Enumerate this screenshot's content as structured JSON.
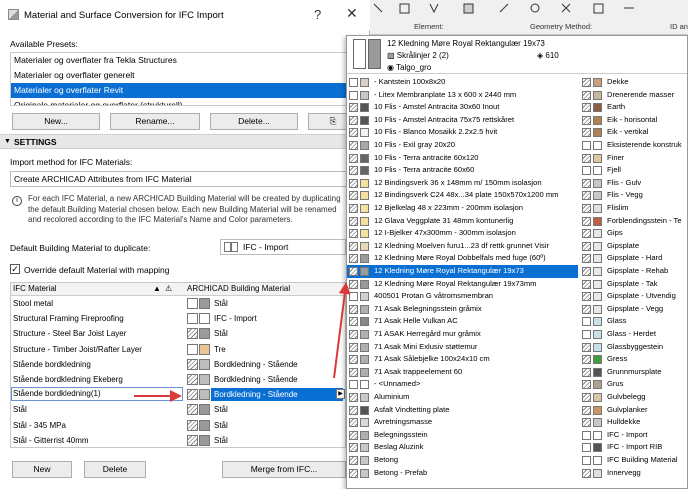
{
  "dialog": {
    "title": "Material and Surface Conversion for IFC Import",
    "help": "?",
    "close": "✕",
    "available_presets_label": "Available Presets:",
    "presets": [
      {
        "label": "Materialer og overflater fra Tekla Structures",
        "selected": false
      },
      {
        "label": "Materialer og overflater generelt",
        "selected": false
      },
      {
        "label": "Materialer og overflater Revit",
        "selected": true
      },
      {
        "label": "Originale materialer og overflater (strukturell)",
        "selected": false
      }
    ],
    "buttons": {
      "new": "New...",
      "rename": "Rename...",
      "delete": "Delete...",
      "import": "⎘"
    },
    "settings_label": "SETTINGS",
    "import_method_label": "Import method for IFC Materials:",
    "import_method_value": "Create ARCHICAD Attributes from IFC Material",
    "info_lines": [
      "For each IFC Material, a new ARCHICAD Building Material will be created by duplicating",
      "the default Building Material chosen below. Each new Building Material will be renamed",
      "and recolored according to the IFC Material's Name and Color parameters."
    ],
    "default_bm_label": "Default Building Material to duplicate:",
    "default_bm_value": "IFC - Import",
    "override_label": "Override default Material with mapping",
    "override_checked": true,
    "table": {
      "col1": "IFC Material",
      "col2": "ARCHICAD Building Material",
      "rows": [
        {
          "ifc": "Stool metal",
          "bm": "Stål",
          "sw": "blank",
          "sw2": "gray"
        },
        {
          "ifc": "Structural Framing Fireproofing",
          "bm": "IFC - Import",
          "sw": "blank",
          "sw2": "blank"
        },
        {
          "ifc": "Structure - Steel Bar Joist Layer",
          "bm": "Stål",
          "sw": "hatch",
          "sw2": "gray"
        },
        {
          "ifc": "Structure - Timber Joist/Rafter Layer",
          "bm": "Tre",
          "sw": "blank",
          "sw2": "tan"
        },
        {
          "ifc": "Stående bordkledning",
          "bm": "Bordkledning - Stående",
          "sw": "hatch",
          "sw2": "lightgray"
        },
        {
          "ifc": "Stående bordkledning Ekeberg",
          "bm": "Bordkledning - Stående",
          "sw": "hatch",
          "sw2": "lightgray"
        },
        {
          "ifc": "Stående bordkledning(1)",
          "bm": "Bordkledning - Stående",
          "sw": "hatch",
          "sw2": "lightgray",
          "selected": true
        },
        {
          "ifc": "Stål",
          "bm": "Stål",
          "sw": "hatch",
          "sw2": "gray"
        },
        {
          "ifc": "Stål - 345 MPa",
          "bm": "Stål",
          "sw": "hatch",
          "sw2": "gray"
        },
        {
          "ifc": "Stål - Gitterrist 40mm",
          "bm": "Stål",
          "sw": "hatch",
          "sw2": "gray"
        }
      ]
    },
    "bottom_buttons": {
      "new": "New",
      "delete": "Delete",
      "merge": "Merge from IFC..."
    }
  },
  "background": {
    "col_element": "Element:",
    "col_geometry": "Geometry Method:",
    "col_id": "ID an"
  },
  "popup": {
    "preview": {
      "name": "12 Kledning Møre Royal Rektangulær 19x73",
      "pattern": "Skrålinjer 2 (2)",
      "priority": "610",
      "surface": "Talgo_gro"
    },
    "left_items": [
      {
        "label": "Kantstein 100x8x20",
        "s1": "blank",
        "s2": "#d8d0c8",
        "prefix": "-"
      },
      {
        "label": "Litex Membranplate 13 x 600 x 2440 mm",
        "s1": "blank",
        "s2": "#c8c8c8",
        "prefix": "-"
      },
      {
        "label": "10  Flis - Amstel Antracita 30x60 Inout",
        "s1": "hatch",
        "s2": "#555555"
      },
      {
        "label": "10  Flis - Amstel Antracita 75x75 rettskåret",
        "s1": "hatch",
        "s2": "#555555"
      },
      {
        "label": "10  Flis - Blanco Mosaikk 2.2x2.5 hvit",
        "s1": "hatch",
        "s2": "#f2f2f2"
      },
      {
        "label": "10  Flis - Exil gray 20x20",
        "s1": "hatch",
        "s2": "#a8a8a8"
      },
      {
        "label": "10  Flis - Terra antracite 60x120",
        "s1": "hatch",
        "s2": "#666666"
      },
      {
        "label": "10  Flis - Terra antracite 60x60",
        "s1": "hatch",
        "s2": "#666666"
      },
      {
        "label": "12  Bindingsverk 36 x 148mm  m/ 150mm isolasjon",
        "s1": "hatch",
        "s2": "#f5e0a0"
      },
      {
        "label": "12  Bindingsverk C24 48x...34 plate 150x570x1200 mm",
        "s1": "hatch",
        "s2": "#f5e0a0"
      },
      {
        "label": "12  Bjelkelag 48 x 223mm - 200mm isolasjon",
        "s1": "hatch",
        "s2": "#f5e0a0"
      },
      {
        "label": "12  Glava Veggplate 31 48mm kontunerlig",
        "s1": "hatch",
        "s2": "#f5e0a0"
      },
      {
        "label": "12  I-Bjelker 47x300mm - 300mm isolasjon",
        "s1": "hatch",
        "s2": "#f5e0a0"
      },
      {
        "label": "12  Kledning Moelven furu1...23 df rettk grunnet Visir",
        "s1": "hatch",
        "s2": "#e8d8b8"
      },
      {
        "label": "12  Kledning Møre Royal Dobbelfals med fuge (60º)",
        "s1": "hatch",
        "s2": "#9a9a9a"
      },
      {
        "label": "12  Kledning Møre Royal Rektangulær 19x73",
        "s1": "hatch",
        "s2": "#9a9a9a",
        "selected": true
      },
      {
        "label": "12  Kledning Møre Royal Rektangulær 19x73mm",
        "s1": "hatch",
        "s2": "#9a9a9a"
      },
      {
        "label": "400501  Protan G våtromsmembran",
        "s1": "blank",
        "s2": "#d0d0d0",
        "noindent": true
      },
      {
        "label": "71  Asak Belegningsstein gråmix",
        "s1": "hatch",
        "s2": "#b0b0b0"
      },
      {
        "label": "71  Asak Helle Vulkan AC",
        "s1": "hatch",
        "s2": "#888888"
      },
      {
        "label": "71  ASAK Herregård mur gråmix",
        "s1": "hatch",
        "s2": "#b0b0b0"
      },
      {
        "label": "71  Asak Mini Exlusiv støttemur",
        "s1": "hatch",
        "s2": "#b0b0b0"
      },
      {
        "label": "71  Asak Sålebjelke 100x24x10 cm",
        "s1": "hatch",
        "s2": "#b0b0b0"
      },
      {
        "label": "71  Asak trappeelement 60",
        "s1": "hatch",
        "s2": "#b0b0b0"
      },
      {
        "label": "<Unnamed>",
        "s1": "blank",
        "s2": "#ffffff",
        "prefix": "-"
      },
      {
        "label": "Aluminium",
        "s1": "hatch",
        "s2": "#c8c8c8"
      },
      {
        "label": "Asfalt Vindtetting plate",
        "s1": "hatch",
        "s2": "#555555"
      },
      {
        "label": "Avretningsmasse",
        "s1": "hatch",
        "s2": "#d8d8d8"
      },
      {
        "label": "Belegningsstein",
        "s1": "hatch",
        "s2": "#b0b0b0"
      },
      {
        "label": "Beslag Aluzink",
        "s1": "hatch",
        "s2": "#c8c8c8"
      },
      {
        "label": "Betong",
        "s1": "hatch",
        "s2": "#c8c8c8"
      },
      {
        "label": "Betong - Prefab",
        "s1": "hatch",
        "s2": "#c8c8c8"
      }
    ],
    "right_items": [
      {
        "label": "Dekke",
        "s1": "hatch",
        "s2": "#c8a080"
      },
      {
        "label": "Drenerende masser",
        "s1": "hatch",
        "s2": "#c8b8a0"
      },
      {
        "label": "Earth",
        "s1": "hatch",
        "s2": "#8a6040"
      },
      {
        "label": "Eik - horisontal",
        "s1": "hatch",
        "s2": "#b08050"
      },
      {
        "label": "Eik - vertikal",
        "s1": "hatch",
        "s2": "#b08050"
      },
      {
        "label": "Eksisterende konstruk",
        "s1": "blank",
        "s2": "#ffffff"
      },
      {
        "label": "Finer",
        "s1": "hatch",
        "s2": "#e0c8a0"
      },
      {
        "label": "Fjell",
        "s1": "blank",
        "s2": "#ffffff"
      },
      {
        "label": "Flis - Gulv",
        "s1": "hatch",
        "s2": "#c8c8c8"
      },
      {
        "label": "Flis - Vegg",
        "s1": "hatch",
        "s2": "#c8c8c8"
      },
      {
        "label": "Flislim",
        "s1": "hatch",
        "s2": "#e0e0e0"
      },
      {
        "label": "Forblendingsstein - Te",
        "s1": "hatch",
        "s2": "#c06040"
      },
      {
        "label": "Gips",
        "s1": "hatch",
        "s2": "#e8e8e8"
      },
      {
        "label": "Gipsplate",
        "s1": "hatch",
        "s2": "#e8e8e8"
      },
      {
        "label": "Gipsplate - Hard",
        "s1": "hatch",
        "s2": "#e8e8e8"
      },
      {
        "label": "Gipsplate - Rehab",
        "s1": "hatch",
        "s2": "#e8e8e8"
      },
      {
        "label": "Gipsplate - Tak",
        "s1": "hatch",
        "s2": "#e8e8e8"
      },
      {
        "label": "Gipsplate - Utvendig",
        "s1": "hatch",
        "s2": "#e8e8e8"
      },
      {
        "label": "Gipsplate - Vegg",
        "s1": "hatch",
        "s2": "#e8e8e8"
      },
      {
        "label": "Glass",
        "s1": "blank",
        "s2": "#c8e0e8"
      },
      {
        "label": "Glass - Herdet",
        "s1": "blank",
        "s2": "#c8e0e8"
      },
      {
        "label": "Glassbyggestein",
        "s1": "hatch",
        "s2": "#c8e0e8"
      },
      {
        "label": "Gress",
        "s1": "hatch",
        "s2": "#40a040"
      },
      {
        "label": "Grunnmursplate",
        "s1": "hatch",
        "s2": "#555555"
      },
      {
        "label": "Grus",
        "s1": "hatch",
        "s2": "#b0a090"
      },
      {
        "label": "Gulvbelegg",
        "s1": "hatch",
        "s2": "#d8c8a8"
      },
      {
        "label": "Gulvplanker",
        "s1": "hatch",
        "s2": "#c89860"
      },
      {
        "label": "Hulldekke",
        "s1": "hatch",
        "s2": "#c8c8c8"
      },
      {
        "label": "IFC - Import",
        "s1": "blank",
        "s2": "#ffffff"
      },
      {
        "label": "IFC - Import RIB",
        "s1": "blank",
        "s2": "#555555"
      },
      {
        "label": "IFC Building Material",
        "s1": "blank",
        "s2": "#ffffff"
      },
      {
        "label": "Innervegg",
        "s1": "hatch",
        "s2": "#e0e0e0"
      }
    ]
  },
  "colors": {
    "selection": "#0a6fd3",
    "arrow": "#d93a3a"
  }
}
